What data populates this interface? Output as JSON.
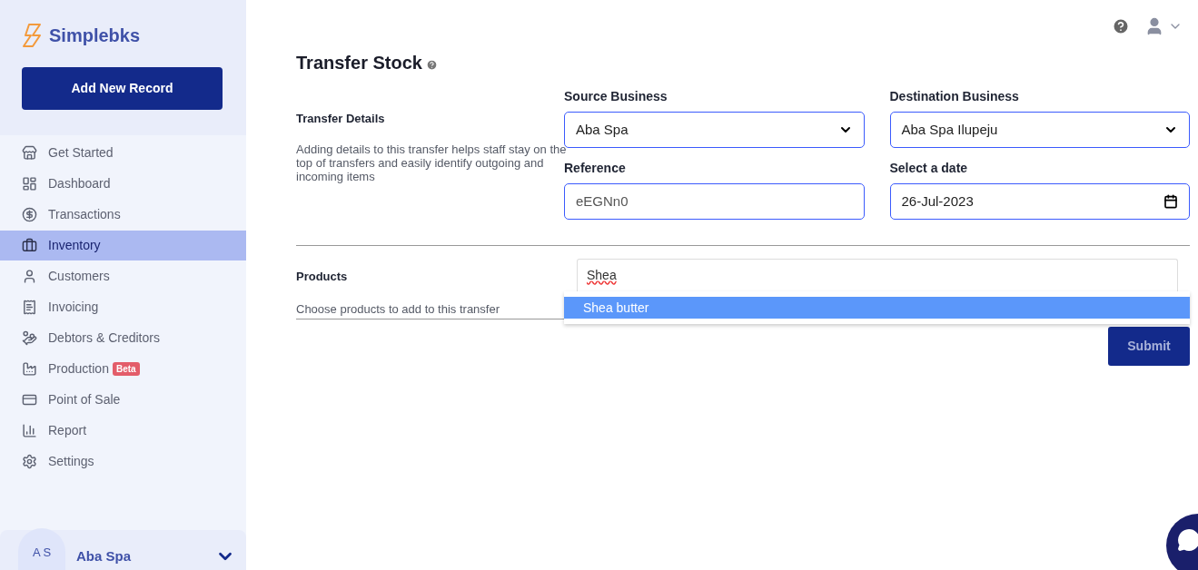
{
  "sidebar": {
    "brand": "Simplebks",
    "add_button": "Add New Record",
    "items": [
      {
        "label": "Get Started",
        "selected": false
      },
      {
        "label": "Dashboard",
        "selected": false
      },
      {
        "label": "Transactions",
        "selected": false
      },
      {
        "label": "Inventory",
        "selected": true
      },
      {
        "label": "Customers",
        "selected": false
      },
      {
        "label": "Invoicing",
        "selected": false
      },
      {
        "label": "Debtors & Creditors",
        "selected": false
      },
      {
        "label": "Production",
        "selected": false,
        "badge": "Beta"
      },
      {
        "label": "Point of Sale",
        "selected": false
      },
      {
        "label": "Report",
        "selected": false
      },
      {
        "label": "Settings",
        "selected": false
      }
    ],
    "account": {
      "initials": "A S",
      "name": "Aba Spa"
    }
  },
  "page": {
    "title": "Transfer Stock",
    "details": {
      "heading": "Transfer Details",
      "description": "Adding details to this transfer helps staff stay on the top of transfers and easily identify outgoing and incoming items"
    },
    "fields": [
      {
        "kind": "select",
        "label": "Source Business",
        "value": "Aba Spa"
      },
      {
        "kind": "select",
        "label": "Destination Business",
        "value": "Aba Spa Ilupeju"
      },
      {
        "kind": "text",
        "label": "Reference",
        "value": "eEGNn0"
      },
      {
        "kind": "date",
        "label": "Select a date",
        "value": "26-Jul-2023"
      }
    ],
    "products": {
      "heading": "Products",
      "description": "Choose products to add to this transfer",
      "search": "Shea",
      "options": [
        {
          "label": "Shea butter",
          "selected": true
        }
      ]
    },
    "submit": "Submit"
  }
}
